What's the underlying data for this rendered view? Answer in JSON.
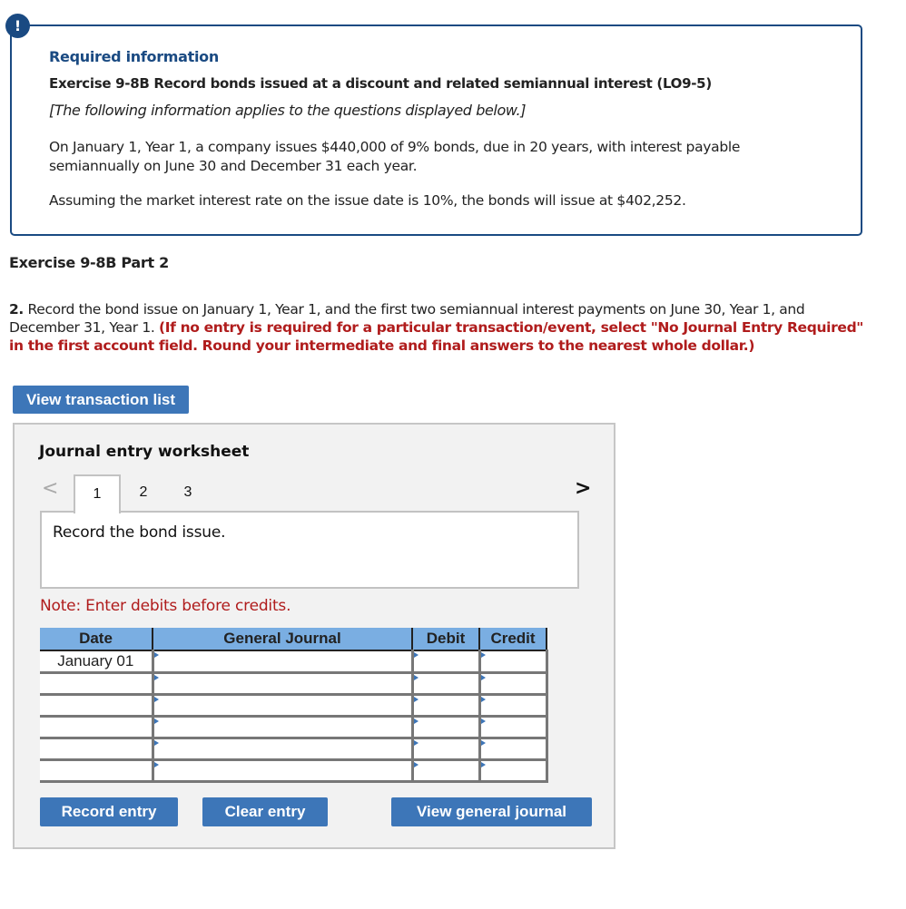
{
  "alert_icon": "exclamation-icon",
  "info": {
    "required_label": "Required information",
    "exercise_title": "Exercise 9-8B Record bonds issued at a discount and related semiannual interest (LO9-5)",
    "applies_note": "[The following information applies to the questions displayed below.]",
    "paragraph1": "On January 1, Year 1, a company issues $440,000 of 9% bonds, due in 20 years, with interest payable semiannually on June 30 and December 31 each year.",
    "paragraph2": "Assuming the market interest rate on the issue date is 10%, the bonds will issue at $402,252."
  },
  "part_title": "Exercise 9-8B Part 2",
  "question": {
    "number": "2.",
    "text": " Record the bond issue on January 1, Year 1, and the first two semiannual interest payments on June 30, Year 1, and December 31, Year 1. ",
    "instruction": "(If no entry is required for a particular transaction/event, select \"No Journal Entry Required\" in the first account field. Round your intermediate and final answers to the nearest whole dollar.)"
  },
  "view_transaction_list_label": "View transaction list",
  "worksheet": {
    "title": "Journal entry worksheet",
    "prev_icon": "<",
    "next_icon": ">",
    "tabs": [
      {
        "label": "1",
        "active": true
      },
      {
        "label": "2",
        "active": false
      },
      {
        "label": "3",
        "active": false
      }
    ],
    "description": "Record the bond issue.",
    "note": "Note: Enter debits before credits.",
    "columns": [
      "Date",
      "General Journal",
      "Debit",
      "Credit"
    ],
    "rows": [
      {
        "date": "January 01",
        "account": "",
        "debit": "",
        "credit": ""
      },
      {
        "date": "",
        "account": "",
        "debit": "",
        "credit": ""
      },
      {
        "date": "",
        "account": "",
        "debit": "",
        "credit": ""
      },
      {
        "date": "",
        "account": "",
        "debit": "",
        "credit": ""
      },
      {
        "date": "",
        "account": "",
        "debit": "",
        "credit": ""
      },
      {
        "date": "",
        "account": "",
        "debit": "",
        "credit": ""
      }
    ],
    "buttons": {
      "record": "Record entry",
      "clear": "Clear entry",
      "view_journal": "View general journal"
    }
  },
  "colors": {
    "brand_blue": "#1a4a82",
    "button_blue": "#3d76b8",
    "header_blue": "#7aaee2",
    "alert_red": "#b01c1c"
  }
}
